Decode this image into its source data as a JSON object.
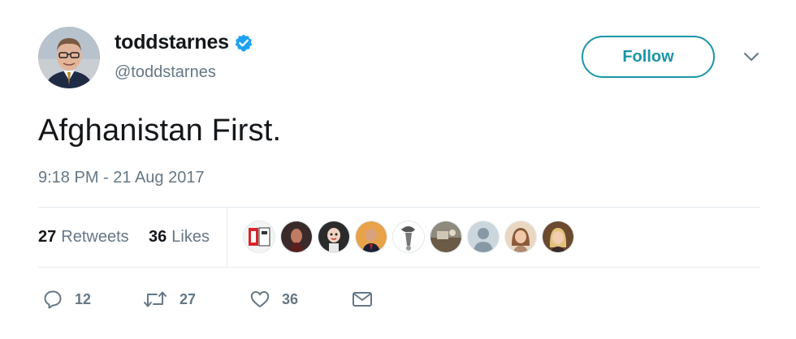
{
  "user": {
    "display_name": "toddstarnes",
    "handle": "@toddstarnes",
    "verified": true,
    "verified_icon": "verified-badge-icon",
    "avatar_icon": "profile-avatar"
  },
  "header": {
    "follow_label": "Follow",
    "more_icon": "chevron-down-icon"
  },
  "tweet": {
    "text": "Afghanistan First.",
    "timestamp": "9:18 PM - 21 Aug 2017"
  },
  "stats": {
    "retweets_count": "27",
    "retweets_label": "Retweets",
    "likes_count": "36",
    "likes_label": "Likes"
  },
  "likers": [
    "liker-avatar-1",
    "liker-avatar-2",
    "liker-avatar-3",
    "liker-avatar-4",
    "liker-avatar-5",
    "liker-avatar-6",
    "liker-avatar-7",
    "liker-avatar-8",
    "liker-avatar-9"
  ],
  "actions": {
    "reply_count": "12",
    "retweet_count": "27",
    "like_count": "36",
    "reply_icon": "reply-icon",
    "retweet_icon": "retweet-icon",
    "like_icon": "heart-icon",
    "dm_icon": "envelope-icon"
  },
  "colors": {
    "accent": "#1b95a8",
    "verified": "#1da1f2",
    "muted": "#657786",
    "text": "#14171a",
    "divider": "#e6ecf0"
  }
}
